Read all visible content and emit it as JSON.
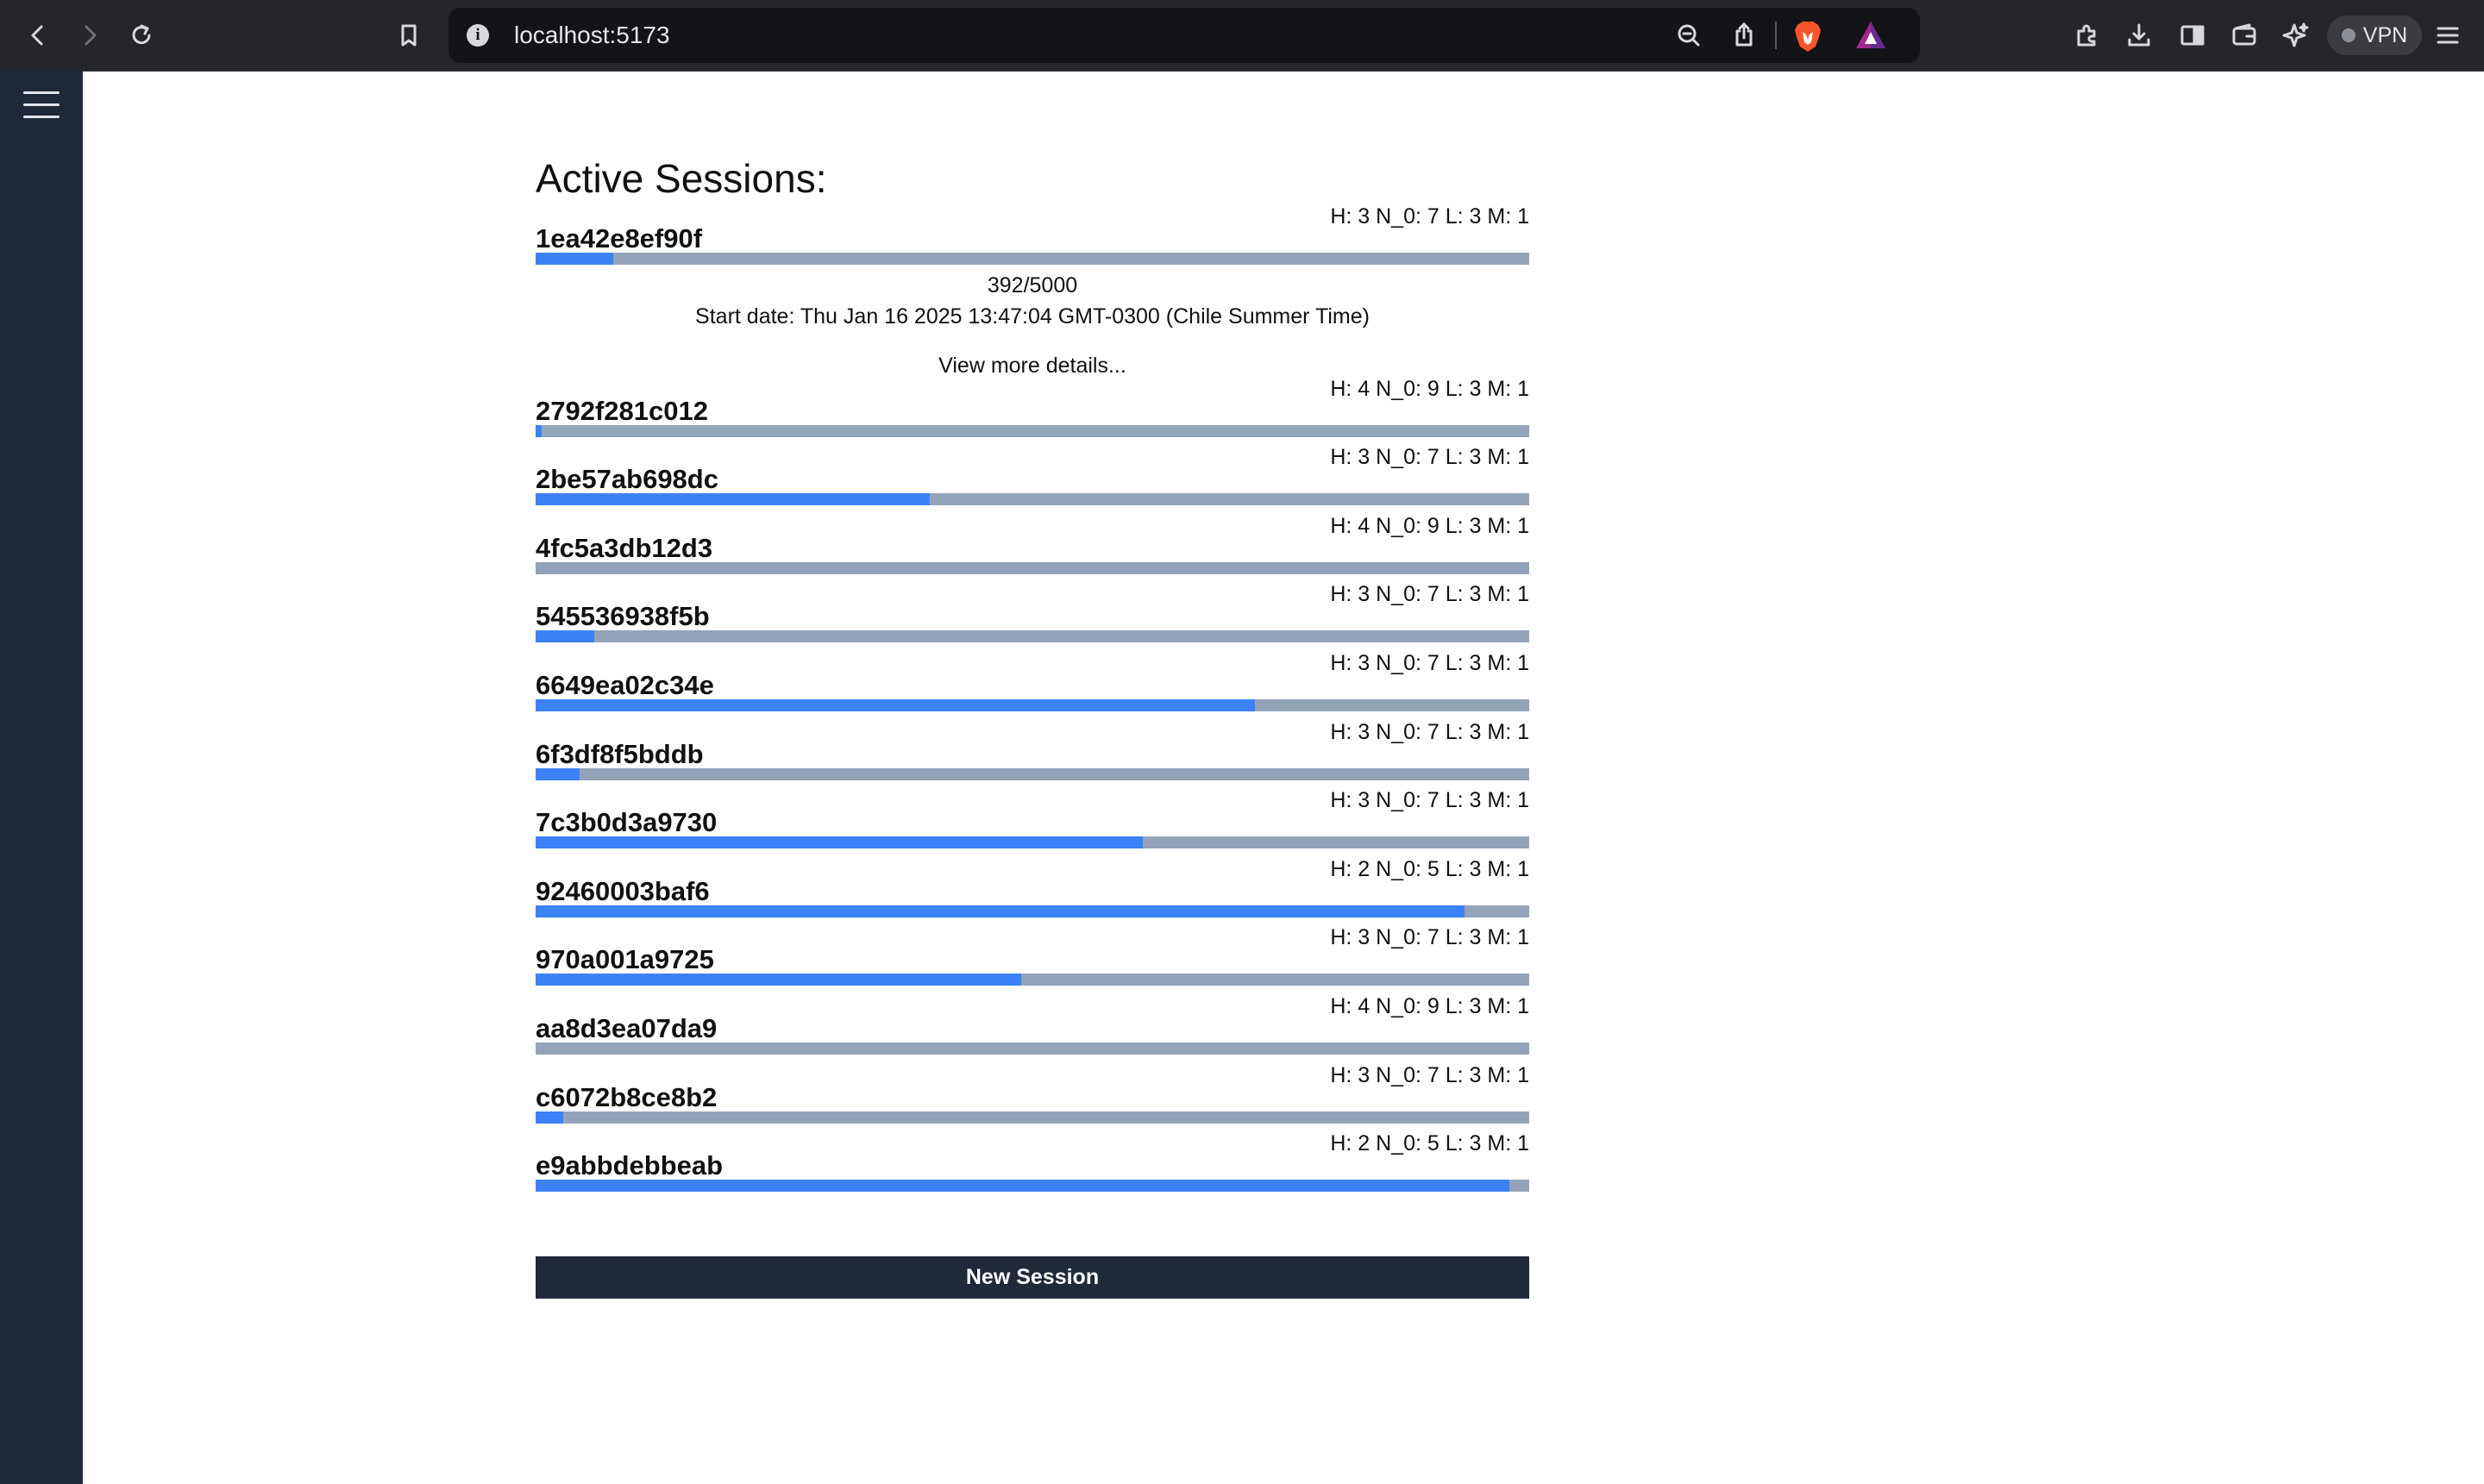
{
  "browser": {
    "url": "localhost:5173",
    "vpn_label": "VPN",
    "icons": [
      "back-icon",
      "forward-icon",
      "reload-icon",
      "bookmark-icon",
      "site-info-icon",
      "zoom-icon",
      "share-icon",
      "brave-shields-icon",
      "brave-rewards-icon",
      "extensions-icon",
      "downloads-icon",
      "sidebar-icon",
      "wallet-icon",
      "leo-ai-icon",
      "menu-icon"
    ]
  },
  "page": {
    "title": "Active Sessions:",
    "new_session_label": "New Session",
    "colors": {
      "sidebar": "#1f2937",
      "progress_fill": "#3b82f6",
      "progress_track": "#94a3b8",
      "button": "#1f2937"
    }
  },
  "sessions": [
    {
      "id": "1ea42e8ef90f",
      "stats": "H: 3 N_0: 7 L: 3 M: 1",
      "progress": 0.0784,
      "expanded": true,
      "progress_text": "392/5000",
      "start_date": "Start date: Thu Jan 16 2025 13:47:04 GMT-0300 (Chile Summer Time)",
      "details_link": "View more details..."
    },
    {
      "id": "2792f281c012",
      "stats": "H: 4 N_0: 9 L: 3 M: 1",
      "progress": 0.006
    },
    {
      "id": "2be57ab698dc",
      "stats": "H: 3 N_0: 7 L: 3 M: 1",
      "progress": 0.397
    },
    {
      "id": "4fc5a3db12d3",
      "stats": "H: 4 N_0: 9 L: 3 M: 1",
      "progress": 0.0
    },
    {
      "id": "545536938f5b",
      "stats": "H: 3 N_0: 7 L: 3 M: 1",
      "progress": 0.059
    },
    {
      "id": "6649ea02c34e",
      "stats": "H: 3 N_0: 7 L: 3 M: 1",
      "progress": 0.724
    },
    {
      "id": "6f3df8f5bddb",
      "stats": "H: 3 N_0: 7 L: 3 M: 1",
      "progress": 0.044
    },
    {
      "id": "7c3b0d3a9730",
      "stats": "H: 3 N_0: 7 L: 3 M: 1",
      "progress": 0.611
    },
    {
      "id": "92460003baf6",
      "stats": "H: 2 N_0: 5 L: 3 M: 1",
      "progress": 0.935
    },
    {
      "id": "970a001a9725",
      "stats": "H: 3 N_0: 7 L: 3 M: 1",
      "progress": 0.489
    },
    {
      "id": "aa8d3ea07da9",
      "stats": "H: 4 N_0: 9 L: 3 M: 1",
      "progress": 0.0
    },
    {
      "id": "c6072b8ce8b2",
      "stats": "H: 3 N_0: 7 L: 3 M: 1",
      "progress": 0.028
    },
    {
      "id": "e9abbdebbeab",
      "stats": "H: 2 N_0: 5 L: 3 M: 1",
      "progress": 0.98
    }
  ]
}
